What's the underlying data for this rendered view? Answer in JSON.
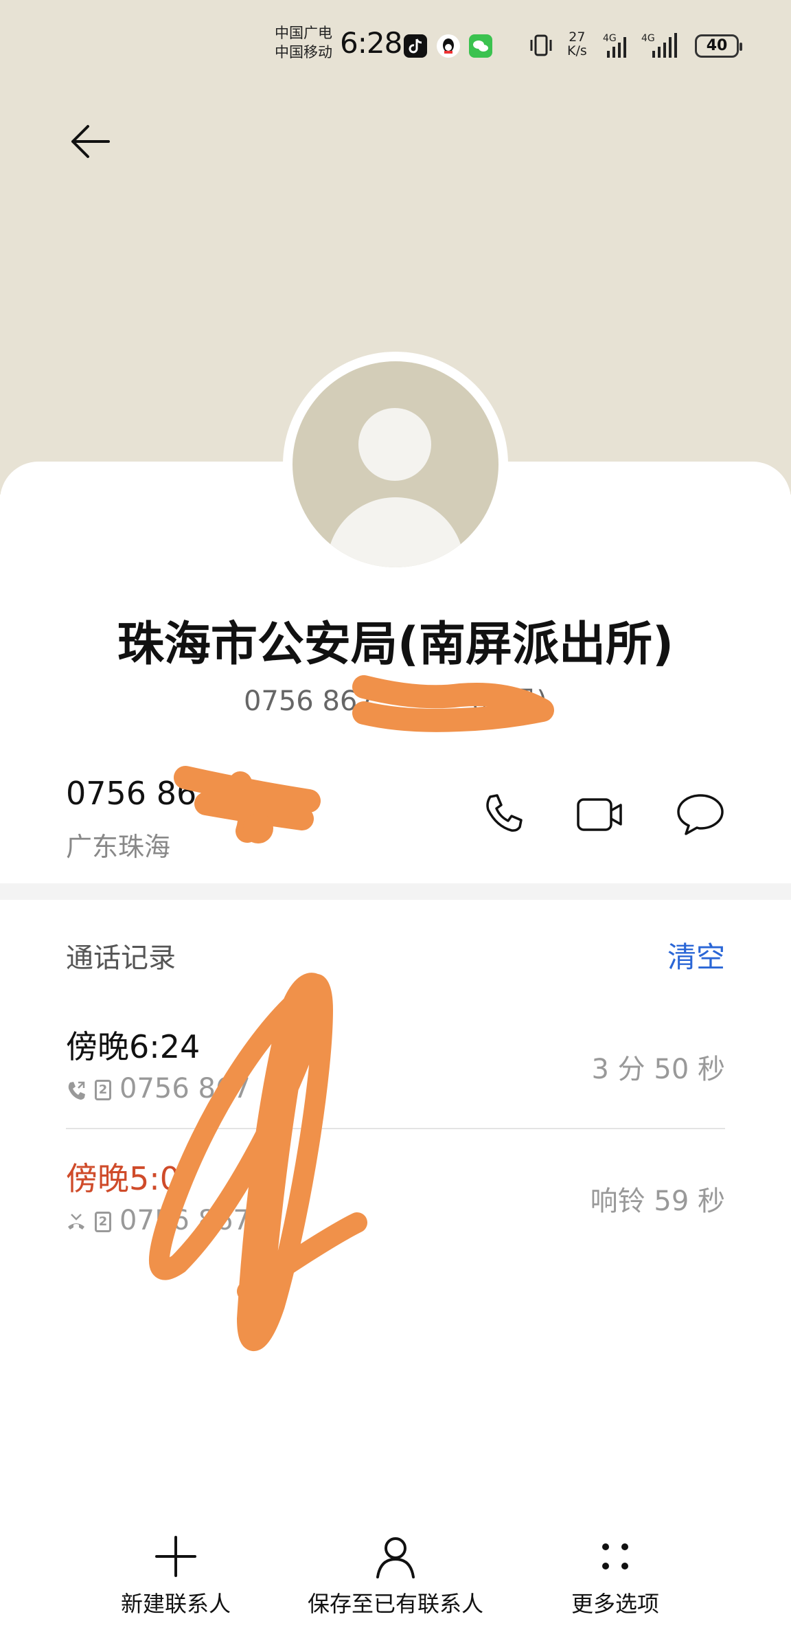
{
  "status_bar": {
    "carrier_1": "中国广电",
    "carrier_2": "中国移动",
    "time": "6:28",
    "speed_value": "27",
    "speed_unit": "K/s",
    "network_1": "4G",
    "network_2": "4G",
    "battery": "40"
  },
  "contact": {
    "name": "珠海市公安局(南屏派出所)",
    "subtitle": "0756 867",
    "subtitle_suffix": "(腾讯)",
    "number": "0756 867",
    "location": "广东珠海"
  },
  "call_log": {
    "title": "通话记录",
    "clear_label": "清空",
    "records": [
      {
        "time": "傍晚6:24",
        "number": "0756 867",
        "sim": "2",
        "duration": "3 分 50 秒",
        "type": "outgoing"
      },
      {
        "time": "傍晚5:07",
        "number": "0756 867",
        "sim": "2",
        "duration": "响铃 59 秒",
        "type": "missed"
      }
    ]
  },
  "bottom_bar": {
    "new_contact": "新建联系人",
    "save_existing": "保存至已有联系人",
    "more_options": "更多选项"
  },
  "colors": {
    "header_bg": "#e7e2d4",
    "accent_blue": "#2a66d6",
    "missed_red": "#cf4b2a",
    "redaction_orange": "#f0914a"
  }
}
